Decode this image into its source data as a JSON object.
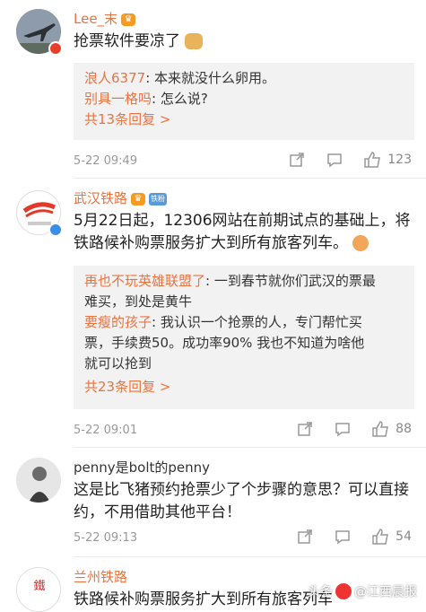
{
  "comments": [
    {
      "user": "Lee_末",
      "content": "抢票软件要凉了",
      "replies": [
        {
          "name": "浪人6377",
          "text": ": 本来就没什么卵用。"
        },
        {
          "name": "别具一格吗",
          "text": ": 怎么说?"
        }
      ],
      "more_replies": "共13条回复 >",
      "time": "5-22 09:49",
      "likes": "123"
    },
    {
      "user": "武汉铁路",
      "avatar_caption": "武汉铁路",
      "content_line1": "5月22日起，12306网站在前期试点的基础上，将",
      "content_line2": "铁路候补购票服务扩大到所有旅客列车。",
      "replies": [
        {
          "name": "再也不玩英雄联盟了",
          "text_line1": ": 一到春节就你们武汉的票最",
          "text_line2": "难买，到处是黄牛"
        },
        {
          "name": "要瘦的孩子",
          "text_line1": ": 我认识一个抢票的人，专门帮忙买",
          "text_line2": "票，手续费50。成功率90%   我也不知道为啥他",
          "text_line3": "就可以抢到"
        }
      ],
      "more_replies": "共23条回复 >",
      "time": "5-22 09:01",
      "likes": "88"
    },
    {
      "user": "penny是bolt的penny",
      "content_line1": "这是比飞猪预约抢票少了个步骤的意思？可以直接",
      "content_line2": "约，不用借助其他平台！",
      "time": "5-22 09:13",
      "likes": "54"
    },
    {
      "user": "兰州铁路",
      "avatar_text": "铁路",
      "content_line1": "铁路候补购票服务扩大到所有旅客列车"
    }
  ],
  "watermark": {
    "prefix": "头条",
    "name": "@江西晨报"
  },
  "colors": {
    "accent": "#eb7340",
    "reply_bg": "#f2f2f2",
    "meta": "#999999"
  }
}
